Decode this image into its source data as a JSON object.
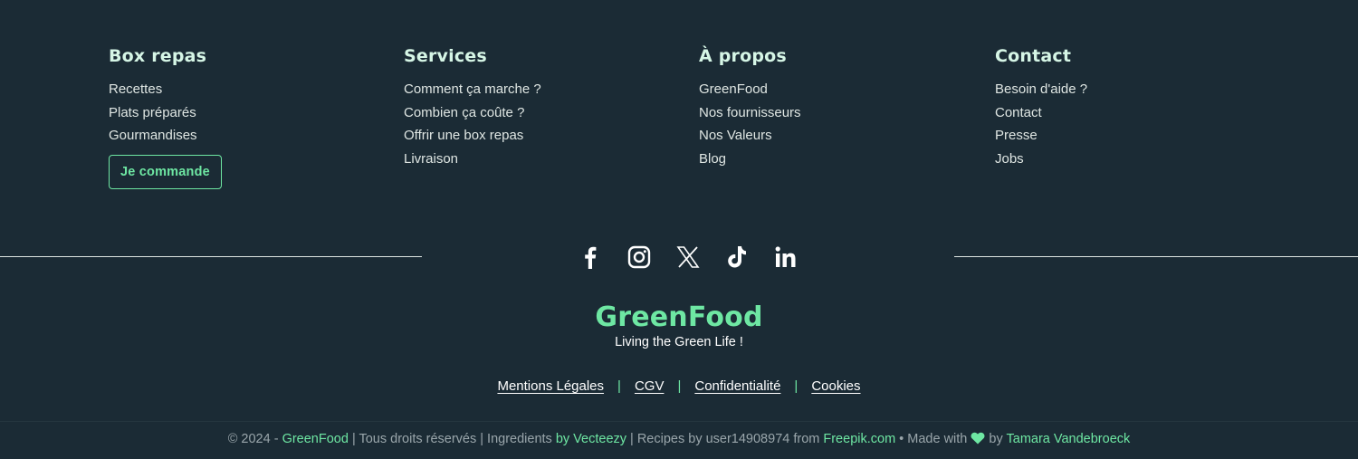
{
  "columns": [
    {
      "title": "Box repas",
      "items": [
        "Recettes",
        "Plats préparés",
        "Gourmandises"
      ],
      "button": "Je commande"
    },
    {
      "title": "Services",
      "items": [
        "Comment ça marche ?",
        "Combien ça coûte ?",
        "Offrir une box repas",
        "Livraison"
      ]
    },
    {
      "title": "À propos",
      "items": [
        "GreenFood",
        "Nos fournisseurs",
        "Nos Valeurs",
        "Blog"
      ]
    },
    {
      "title": "Contact",
      "items": [
        "Besoin d'aide ?",
        "Contact",
        "Presse",
        "Jobs"
      ]
    }
  ],
  "social": [
    "facebook-icon",
    "instagram-icon",
    "x-icon",
    "tiktok-icon",
    "linkedin-icon"
  ],
  "brand": {
    "name": "GreenFood",
    "tagline": "Living the Green Life !"
  },
  "legal": {
    "separator": "|",
    "links": [
      "Mentions Légales",
      "CGV",
      "Confidentialité",
      "Cookies"
    ]
  },
  "credits": {
    "copyright": "© 2024 - ",
    "brand": "GreenFood",
    "rights": " | Tous droits réservés | Ingredients ",
    "vecteezy": "by Vecteezy",
    "recipes": " | Recipes by user14908974 from ",
    "freepik": "Freepik.com",
    "made_with": " • Made with ",
    "by": " by ",
    "author": "Tamara Vandebroeck"
  },
  "colors": {
    "background": "#1b2b35",
    "accent": "#6ee7a3",
    "text": "#dfe6e3"
  }
}
